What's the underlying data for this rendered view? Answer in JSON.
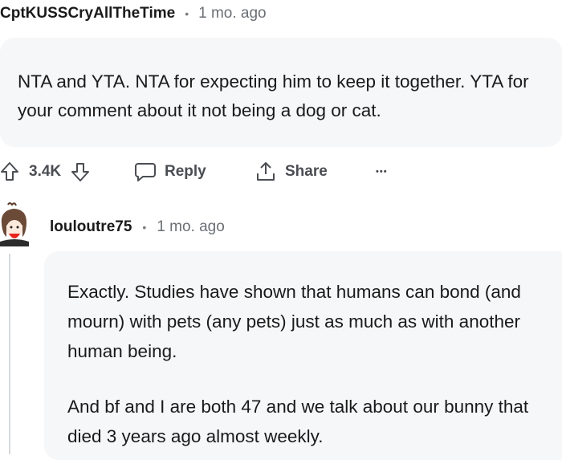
{
  "comment": {
    "author": "CptKUSSCryAllTheTime",
    "separator": "•",
    "time": "1 mo. ago",
    "body": "NTA and YTA. NTA for expecting him to keep it together. YTA for your comment about it not being a dog or cat.",
    "actions": {
      "upvote_icon": "arrow-up-icon",
      "score": "3.4K",
      "downvote_icon": "arrow-down-icon",
      "reply_label": "Reply",
      "share_label": "Share",
      "more_label": "•••"
    }
  },
  "reply": {
    "author": "louloutre75",
    "separator": "•",
    "time": "1 mo. ago",
    "paragraphs": [
      "Exactly. Studies have shown that humans can bond (and mourn) with pets (any pets) just as much as with another human being.",
      "And bf and I are both 47 and we talk about our bunny that died 3 years ago almost weekly."
    ]
  },
  "colors": {
    "bubble_bg": "#f6f7f8",
    "text": "#1a1a1b",
    "muted": "#6b6f74",
    "thread_line": "#d7dadc",
    "avatar_accent": "#e8231b"
  }
}
